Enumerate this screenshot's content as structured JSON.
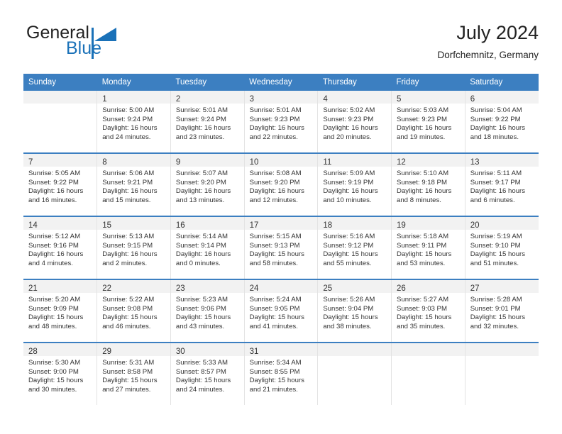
{
  "brand": {
    "name_part1": "General",
    "name_part2": "Blue",
    "accent_color": "#1a71b8"
  },
  "header": {
    "title": "July 2024",
    "subtitle": "Dorfchemnitz, Germany"
  },
  "calendar": {
    "header_color": "#3c7fc1",
    "weekday_headers": [
      "Sunday",
      "Monday",
      "Tuesday",
      "Wednesday",
      "Thursday",
      "Friday",
      "Saturday"
    ],
    "weeks": [
      [
        {
          "day": "",
          "lines": []
        },
        {
          "day": "1",
          "lines": [
            "Sunrise: 5:00 AM",
            "Sunset: 9:24 PM",
            "Daylight: 16 hours",
            "and 24 minutes."
          ]
        },
        {
          "day": "2",
          "lines": [
            "Sunrise: 5:01 AM",
            "Sunset: 9:24 PM",
            "Daylight: 16 hours",
            "and 23 minutes."
          ]
        },
        {
          "day": "3",
          "lines": [
            "Sunrise: 5:01 AM",
            "Sunset: 9:23 PM",
            "Daylight: 16 hours",
            "and 22 minutes."
          ]
        },
        {
          "day": "4",
          "lines": [
            "Sunrise: 5:02 AM",
            "Sunset: 9:23 PM",
            "Daylight: 16 hours",
            "and 20 minutes."
          ]
        },
        {
          "day": "5",
          "lines": [
            "Sunrise: 5:03 AM",
            "Sunset: 9:23 PM",
            "Daylight: 16 hours",
            "and 19 minutes."
          ]
        },
        {
          "day": "6",
          "lines": [
            "Sunrise: 5:04 AM",
            "Sunset: 9:22 PM",
            "Daylight: 16 hours",
            "and 18 minutes."
          ]
        }
      ],
      [
        {
          "day": "7",
          "lines": [
            "Sunrise: 5:05 AM",
            "Sunset: 9:22 PM",
            "Daylight: 16 hours",
            "and 16 minutes."
          ]
        },
        {
          "day": "8",
          "lines": [
            "Sunrise: 5:06 AM",
            "Sunset: 9:21 PM",
            "Daylight: 16 hours",
            "and 15 minutes."
          ]
        },
        {
          "day": "9",
          "lines": [
            "Sunrise: 5:07 AM",
            "Sunset: 9:20 PM",
            "Daylight: 16 hours",
            "and 13 minutes."
          ]
        },
        {
          "day": "10",
          "lines": [
            "Sunrise: 5:08 AM",
            "Sunset: 9:20 PM",
            "Daylight: 16 hours",
            "and 12 minutes."
          ]
        },
        {
          "day": "11",
          "lines": [
            "Sunrise: 5:09 AM",
            "Sunset: 9:19 PM",
            "Daylight: 16 hours",
            "and 10 minutes."
          ]
        },
        {
          "day": "12",
          "lines": [
            "Sunrise: 5:10 AM",
            "Sunset: 9:18 PM",
            "Daylight: 16 hours",
            "and 8 minutes."
          ]
        },
        {
          "day": "13",
          "lines": [
            "Sunrise: 5:11 AM",
            "Sunset: 9:17 PM",
            "Daylight: 16 hours",
            "and 6 minutes."
          ]
        }
      ],
      [
        {
          "day": "14",
          "lines": [
            "Sunrise: 5:12 AM",
            "Sunset: 9:16 PM",
            "Daylight: 16 hours",
            "and 4 minutes."
          ]
        },
        {
          "day": "15",
          "lines": [
            "Sunrise: 5:13 AM",
            "Sunset: 9:15 PM",
            "Daylight: 16 hours",
            "and 2 minutes."
          ]
        },
        {
          "day": "16",
          "lines": [
            "Sunrise: 5:14 AM",
            "Sunset: 9:14 PM",
            "Daylight: 16 hours",
            "and 0 minutes."
          ]
        },
        {
          "day": "17",
          "lines": [
            "Sunrise: 5:15 AM",
            "Sunset: 9:13 PM",
            "Daylight: 15 hours",
            "and 58 minutes."
          ]
        },
        {
          "day": "18",
          "lines": [
            "Sunrise: 5:16 AM",
            "Sunset: 9:12 PM",
            "Daylight: 15 hours",
            "and 55 minutes."
          ]
        },
        {
          "day": "19",
          "lines": [
            "Sunrise: 5:18 AM",
            "Sunset: 9:11 PM",
            "Daylight: 15 hours",
            "and 53 minutes."
          ]
        },
        {
          "day": "20",
          "lines": [
            "Sunrise: 5:19 AM",
            "Sunset: 9:10 PM",
            "Daylight: 15 hours",
            "and 51 minutes."
          ]
        }
      ],
      [
        {
          "day": "21",
          "lines": [
            "Sunrise: 5:20 AM",
            "Sunset: 9:09 PM",
            "Daylight: 15 hours",
            "and 48 minutes."
          ]
        },
        {
          "day": "22",
          "lines": [
            "Sunrise: 5:22 AM",
            "Sunset: 9:08 PM",
            "Daylight: 15 hours",
            "and 46 minutes."
          ]
        },
        {
          "day": "23",
          "lines": [
            "Sunrise: 5:23 AM",
            "Sunset: 9:06 PM",
            "Daylight: 15 hours",
            "and 43 minutes."
          ]
        },
        {
          "day": "24",
          "lines": [
            "Sunrise: 5:24 AM",
            "Sunset: 9:05 PM",
            "Daylight: 15 hours",
            "and 41 minutes."
          ]
        },
        {
          "day": "25",
          "lines": [
            "Sunrise: 5:26 AM",
            "Sunset: 9:04 PM",
            "Daylight: 15 hours",
            "and 38 minutes."
          ]
        },
        {
          "day": "26",
          "lines": [
            "Sunrise: 5:27 AM",
            "Sunset: 9:03 PM",
            "Daylight: 15 hours",
            "and 35 minutes."
          ]
        },
        {
          "day": "27",
          "lines": [
            "Sunrise: 5:28 AM",
            "Sunset: 9:01 PM",
            "Daylight: 15 hours",
            "and 32 minutes."
          ]
        }
      ],
      [
        {
          "day": "28",
          "lines": [
            "Sunrise: 5:30 AM",
            "Sunset: 9:00 PM",
            "Daylight: 15 hours",
            "and 30 minutes."
          ]
        },
        {
          "day": "29",
          "lines": [
            "Sunrise: 5:31 AM",
            "Sunset: 8:58 PM",
            "Daylight: 15 hours",
            "and 27 minutes."
          ]
        },
        {
          "day": "30",
          "lines": [
            "Sunrise: 5:33 AM",
            "Sunset: 8:57 PM",
            "Daylight: 15 hours",
            "and 24 minutes."
          ]
        },
        {
          "day": "31",
          "lines": [
            "Sunrise: 5:34 AM",
            "Sunset: 8:55 PM",
            "Daylight: 15 hours",
            "and 21 minutes."
          ]
        },
        {
          "day": "",
          "lines": []
        },
        {
          "day": "",
          "lines": []
        },
        {
          "day": "",
          "lines": []
        }
      ]
    ]
  }
}
